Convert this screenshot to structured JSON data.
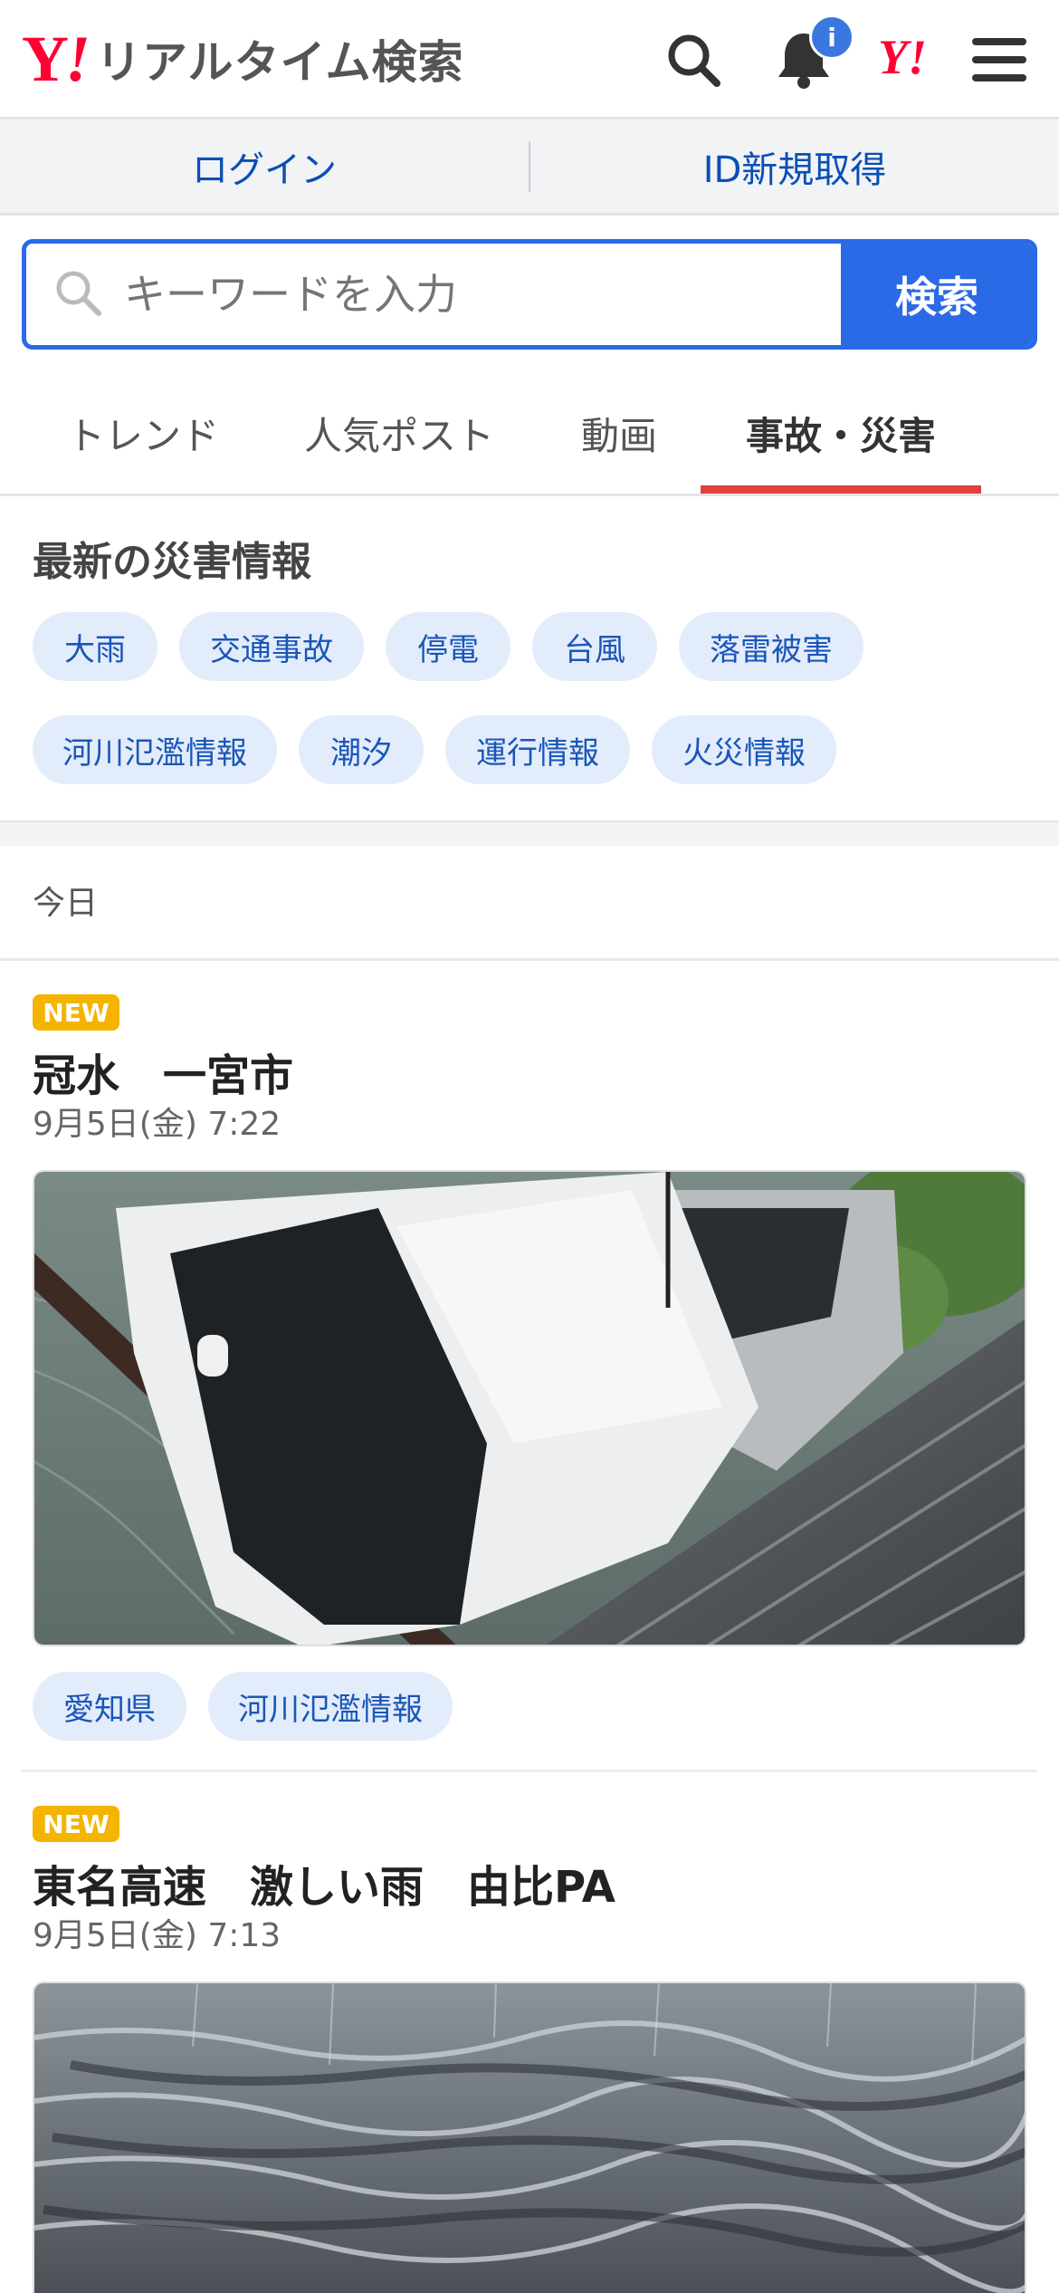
{
  "header": {
    "logo_y": "Y",
    "logo_mark": "!",
    "logo_text": "リアルタイム検索",
    "notification_badge": "i",
    "yahoo_mark": "Y!"
  },
  "account": {
    "login_label": "ログイン",
    "register_label": "ID新規取得"
  },
  "search": {
    "placeholder": "キーワードを入力",
    "button_label": "検索"
  },
  "tabs": [
    {
      "label": "トレンド"
    },
    {
      "label": "人気ポスト"
    },
    {
      "label": "動画"
    },
    {
      "label": "事故・災害",
      "active": true
    }
  ],
  "disaster": {
    "title": "最新の災害情報",
    "chips": [
      "大雨",
      "交通事故",
      "停電",
      "台風",
      "落雷被害",
      "河川氾濫情報",
      "潮汐",
      "運行情報",
      "火災情報"
    ]
  },
  "feed": {
    "date_header": "今日",
    "posts": [
      {
        "badge": "NEW",
        "title": "冠水　一宮市",
        "time": "9月5日(金) 7:22",
        "image": "flooded-car-photo",
        "tags": [
          "愛知県",
          "河川氾濫情報"
        ]
      },
      {
        "badge": "NEW",
        "title": "東名高速　激しい雨　由比PA",
        "time": "9月5日(金) 7:13",
        "image": "heavy-rain-photo"
      }
    ]
  },
  "colors": {
    "brand_red": "#ff0033",
    "accent_blue": "#2a6ae6",
    "chip_bg": "#e3ecfb",
    "new_badge": "#f4b400",
    "active_tab_underline": "#e04040"
  }
}
